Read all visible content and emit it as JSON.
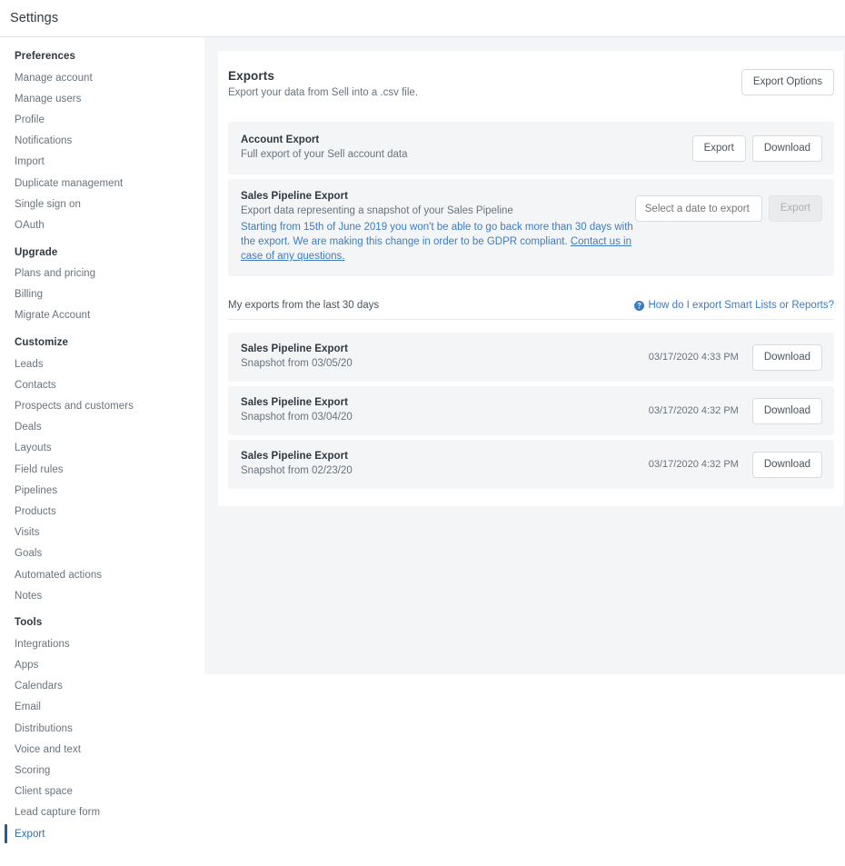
{
  "app": {
    "title": "Settings"
  },
  "sidebar": {
    "groups": [
      {
        "title": "Preferences",
        "items": [
          {
            "label": "Manage account",
            "active": false
          },
          {
            "label": "Manage users",
            "active": false
          },
          {
            "label": "Profile",
            "active": false
          },
          {
            "label": "Notifications",
            "active": false
          },
          {
            "label": "Import",
            "active": false
          },
          {
            "label": "Duplicate management",
            "active": false
          },
          {
            "label": "Single sign on",
            "active": false
          },
          {
            "label": "OAuth",
            "active": false
          }
        ]
      },
      {
        "title": "Upgrade",
        "items": [
          {
            "label": "Plans and pricing",
            "active": false
          },
          {
            "label": "Billing",
            "active": false
          },
          {
            "label": "Migrate Account",
            "active": false
          }
        ]
      },
      {
        "title": "Customize",
        "items": [
          {
            "label": "Leads",
            "active": false
          },
          {
            "label": "Contacts",
            "active": false
          },
          {
            "label": "Prospects and customers",
            "active": false
          },
          {
            "label": "Deals",
            "active": false
          },
          {
            "label": "Layouts",
            "active": false
          },
          {
            "label": "Field rules",
            "active": false
          },
          {
            "label": "Pipelines",
            "active": false
          },
          {
            "label": "Products",
            "active": false
          },
          {
            "label": "Visits",
            "active": false
          },
          {
            "label": "Goals",
            "active": false
          },
          {
            "label": "Automated actions",
            "active": false
          },
          {
            "label": "Notes",
            "active": false
          }
        ]
      },
      {
        "title": "Tools",
        "items": [
          {
            "label": "Integrations",
            "active": false
          },
          {
            "label": "Apps",
            "active": false
          },
          {
            "label": "Calendars",
            "active": false
          },
          {
            "label": "Email",
            "active": false
          },
          {
            "label": "Distributions",
            "active": false
          },
          {
            "label": "Voice and text",
            "active": false
          },
          {
            "label": "Scoring",
            "active": false
          },
          {
            "label": "Client space",
            "active": false
          },
          {
            "label": "Lead capture form",
            "active": false
          },
          {
            "label": "Export",
            "active": true
          }
        ]
      }
    ]
  },
  "main": {
    "heading": "Exports",
    "subheading": "Export your data from Sell into a .csv file.",
    "export_options_button": "Export Options",
    "account_export": {
      "title": "Account Export",
      "description": "Full export of your Sell account data",
      "export_button": "Export",
      "download_button": "Download"
    },
    "pipeline_export": {
      "title": "Sales Pipeline Export",
      "description": "Export data representing a snapshot of your Sales Pipeline",
      "notice_part1": "Starting from 15th of June 2019 you won't be able to go back more than 30 days with the export. We are making this change in order to be GDPR compliant. ",
      "notice_link": "Contact us in case of any questions.",
      "date_placeholder": "Select a date to export",
      "date_value": "",
      "export_button": "Export",
      "export_button_disabled": true
    },
    "exports_list": {
      "label": "My exports from the last 30 days",
      "help_link": "How do I export Smart Lists or Reports?",
      "help_icon": "question-circle-icon",
      "download_button": "Download",
      "rows": [
        {
          "title": "Sales Pipeline Export",
          "subtitle": "Snapshot from 03/05/20",
          "timestamp": "03/17/2020 4:33 PM",
          "action": "Download"
        },
        {
          "title": "Sales Pipeline Export",
          "subtitle": "Snapshot from 03/04/20",
          "timestamp": "03/17/2020 4:32 PM",
          "action": "Download"
        },
        {
          "title": "Sales Pipeline Export",
          "subtitle": "Snapshot from 02/23/20",
          "timestamp": "03/17/2020 4:32 PM",
          "action": "Download"
        }
      ]
    }
  },
  "colors": {
    "accent_blue": "#3d7cc1",
    "active_bar": "#1f5c99",
    "page_bg": "#f4f5f7",
    "panel_bg": "#f4f5f7",
    "text_primary": "#2f3941",
    "text_secondary": "#68737d"
  }
}
